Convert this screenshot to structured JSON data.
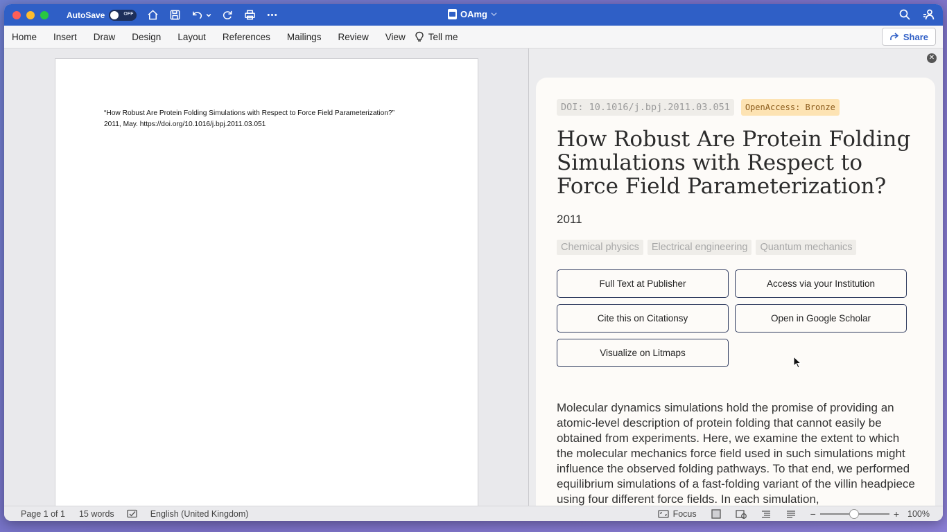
{
  "titlebar": {
    "autosave_label": "AutoSave",
    "autosave_state": "OFF",
    "doc_title": "OAmg"
  },
  "ribbon": {
    "tabs": [
      "Home",
      "Insert",
      "Draw",
      "Design",
      "Layout",
      "References",
      "Mailings",
      "Review",
      "View"
    ],
    "tell_me": "Tell me",
    "share": "Share"
  },
  "document": {
    "line1": "“How Robust Are Protein Folding Simulations with Respect to Force Field Parameterization?”",
    "line2": "2011, May. https://doi.org/10.1016/j.bpj.2011.03.051"
  },
  "pane": {
    "doi": "DOI: 10.1016/j.bpj.2011.03.051",
    "open_access": "OpenAccess: Bronze",
    "title": "How Robust Are Protein Folding Simulations with Respect to Force Field Parameterization?",
    "year": "2011",
    "tags": [
      "Chemical physics",
      "Electrical engineering",
      "Quantum mechanics"
    ],
    "buttons": {
      "full_text": "Full Text at Publisher",
      "institution": "Access via your Institution",
      "citationsy": "Cite this on Citationsy",
      "scholar": "Open in Google Scholar",
      "litmaps": "Visualize on Litmaps"
    },
    "abstract": "Molecular dynamics simulations hold the promise of providing an atomic-level description of protein folding that cannot easily be obtained from experiments. Here, we examine the extent to which the molecular mechanics force field used in such simulations might influence the observed folding pathways. To that end, we performed equilibrium simulations of a fast-folding variant of the villin headpiece using four different force fields. In each simulation,"
  },
  "statusbar": {
    "page": "Page 1 of 1",
    "words": "15 words",
    "language": "English (United Kingdom)",
    "focus": "Focus",
    "zoom": "100%"
  },
  "colors": {
    "titlebar": "#2f5fc6",
    "oa_badge_bg": "#fde3b3",
    "button_border": "#2e3a5e"
  }
}
